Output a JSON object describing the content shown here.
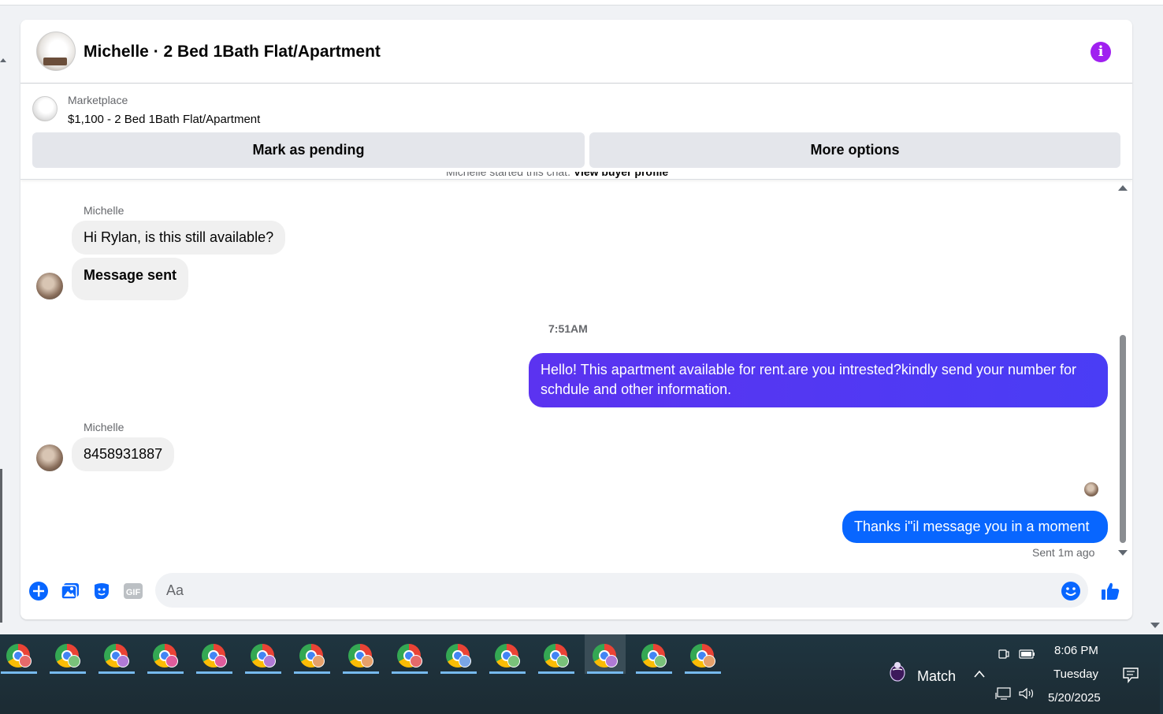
{
  "conversation": {
    "title": "Michelle · 2 Bed 1Bath Flat/Apartment"
  },
  "listing": {
    "source": "Marketplace",
    "price_title": "$1,100 - 2 Bed 1Bath Flat/Apartment",
    "pending_button": "Mark as pending",
    "more_button": "More options"
  },
  "chat": {
    "cutoff_text": "Michelle started this chat.",
    "cutoff_link": "View buyer profile",
    "group1": {
      "sender": "Michelle",
      "messages": [
        "Hi Rylan, is this still available?",
        "Message sent"
      ]
    },
    "timestamp": "7:51AM",
    "outgoing1": "Hello! This apartment available for rent.are you intrested?kindly send your number for schdule and other information.",
    "group2": {
      "sender": "Michelle",
      "message": "8458931887"
    },
    "outgoing2": "Thanks i\"il message you in a moment",
    "sent_status": "Sent 1m ago"
  },
  "composer": {
    "placeholder": "Aa",
    "icons": [
      "add-icon",
      "photo-icon",
      "sticker-icon",
      "gif-icon",
      "emoji-icon",
      "like-icon"
    ],
    "gif_label": "GIF"
  },
  "taskbar": {
    "app_badge_colors": [
      "#e66a6a",
      "#7ac27a",
      "#b07ad6",
      "#e05c9c",
      "#e05c9c",
      "#b07ad6",
      "#e6a06a",
      "#e6a06a",
      "#e66a6a",
      "#7aa6e6",
      "#7ac27a",
      "#7ac27a",
      "#b07ad6",
      "#7ac27a",
      "#e6a06a"
    ],
    "active_index": 12,
    "match_label": "Match",
    "time": "8:06 PM",
    "day": "Tuesday",
    "date": "5/20/2025"
  },
  "colors": {
    "info_accent": "#a020f0",
    "outgoing_purple": "#4a3df5",
    "outgoing_blue": "#0866ff",
    "composer_accent": "#0866ff"
  }
}
